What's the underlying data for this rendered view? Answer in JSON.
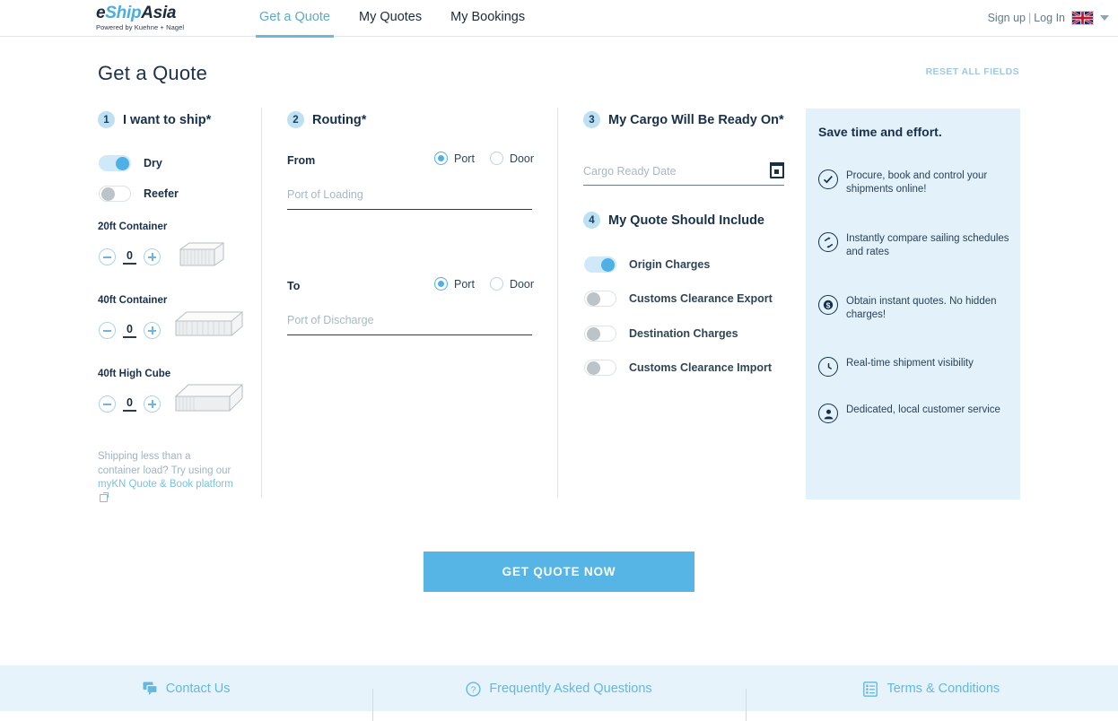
{
  "header": {
    "logo_main_e": "e",
    "logo_main_ship": "Ship",
    "logo_main_asia": "Asia",
    "logo_tagline": "Powered by Kuehne + Nagel",
    "nav": [
      {
        "label": "Get a Quote",
        "active": true
      },
      {
        "label": "My Quotes",
        "active": false
      },
      {
        "label": "My Bookings",
        "active": false
      }
    ],
    "sign_up": "Sign up",
    "separator": "|",
    "log_in": "Log In",
    "flag_icon": "uk-flag-icon",
    "caret_icon": "chevron-down-icon"
  },
  "page": {
    "title": "Get a Quote",
    "reset_label": "RESET ALL FIELDS"
  },
  "section1": {
    "number": "1",
    "title": "I want to ship*",
    "toggles": [
      {
        "label": "Dry",
        "on": true
      },
      {
        "label": "Reefer",
        "on": false
      }
    ],
    "containers": [
      {
        "label": "20ft Container",
        "value": "0",
        "minus": "minus-icon",
        "plus": "plus-icon"
      },
      {
        "label": "40ft Container",
        "value": "0",
        "minus": "minus-icon",
        "plus": "plus-icon"
      },
      {
        "label": "40ft High Cube",
        "value": "0",
        "minus": "minus-icon",
        "plus": "plus-icon"
      }
    ],
    "lcl_text_1": "Shipping less than a container load? Try using our ",
    "lcl_link": "myKN Quote & Book platform",
    "lcl_external_icon": "external-link-icon"
  },
  "section2": {
    "number": "2",
    "title": "Routing*",
    "from": {
      "label": "From",
      "options": [
        {
          "label": "Port",
          "selected": true
        },
        {
          "label": "Door",
          "selected": false
        }
      ],
      "placeholder": "Port of Loading",
      "value": ""
    },
    "to": {
      "label": "To",
      "options": [
        {
          "label": "Port",
          "selected": true
        },
        {
          "label": "Door",
          "selected": false
        }
      ],
      "placeholder": "Port of Discharge",
      "value": ""
    }
  },
  "section3": {
    "number": "3",
    "title": "My Cargo Will Be Ready On*",
    "date_placeholder": "Cargo Ready Date",
    "date_value": "",
    "calendar_icon": "calendar-icon"
  },
  "section4": {
    "number": "4",
    "title": "My Quote Should Include",
    "toggles": [
      {
        "label": "Origin Charges",
        "on": true
      },
      {
        "label": "Customs Clearance Export",
        "on": false
      },
      {
        "label": "Destination Charges",
        "on": false
      },
      {
        "label": "Customs Clearance Import",
        "on": false
      }
    ]
  },
  "panel": {
    "title": "Save time and effort.",
    "benefits": [
      {
        "icon": "check-circle-icon",
        "glyph": "✓",
        "text": "Procure, book and control your shipments online!"
      },
      {
        "icon": "compare-arrows-icon",
        "glyph": "⇄",
        "text": "Instantly compare sailing schedules and rates"
      },
      {
        "icon": "dollar-circle-icon",
        "glyph": "$",
        "text": "Obtain instant quotes. No hidden charges!"
      },
      {
        "icon": "clock-icon",
        "glyph": "◴",
        "text": "Real-time shipment visibility"
      },
      {
        "icon": "person-icon",
        "glyph": "●",
        "text": "Dedicated, local customer service"
      }
    ]
  },
  "cta": {
    "label": "GET QUOTE NOW"
  },
  "footer": {
    "items": [
      {
        "label": "Contact Us",
        "icon": "chat-icon"
      },
      {
        "label": "Frequently Asked Questions",
        "icon": "question-circle-icon"
      },
      {
        "label": "Terms & Conditions",
        "icon": "document-list-icon"
      }
    ]
  },
  "colors": {
    "accent": "#56b5e5",
    "dark": "#18304a",
    "panel_bg": "#e2f1fa",
    "footer_bg": "#e6f3fb"
  }
}
